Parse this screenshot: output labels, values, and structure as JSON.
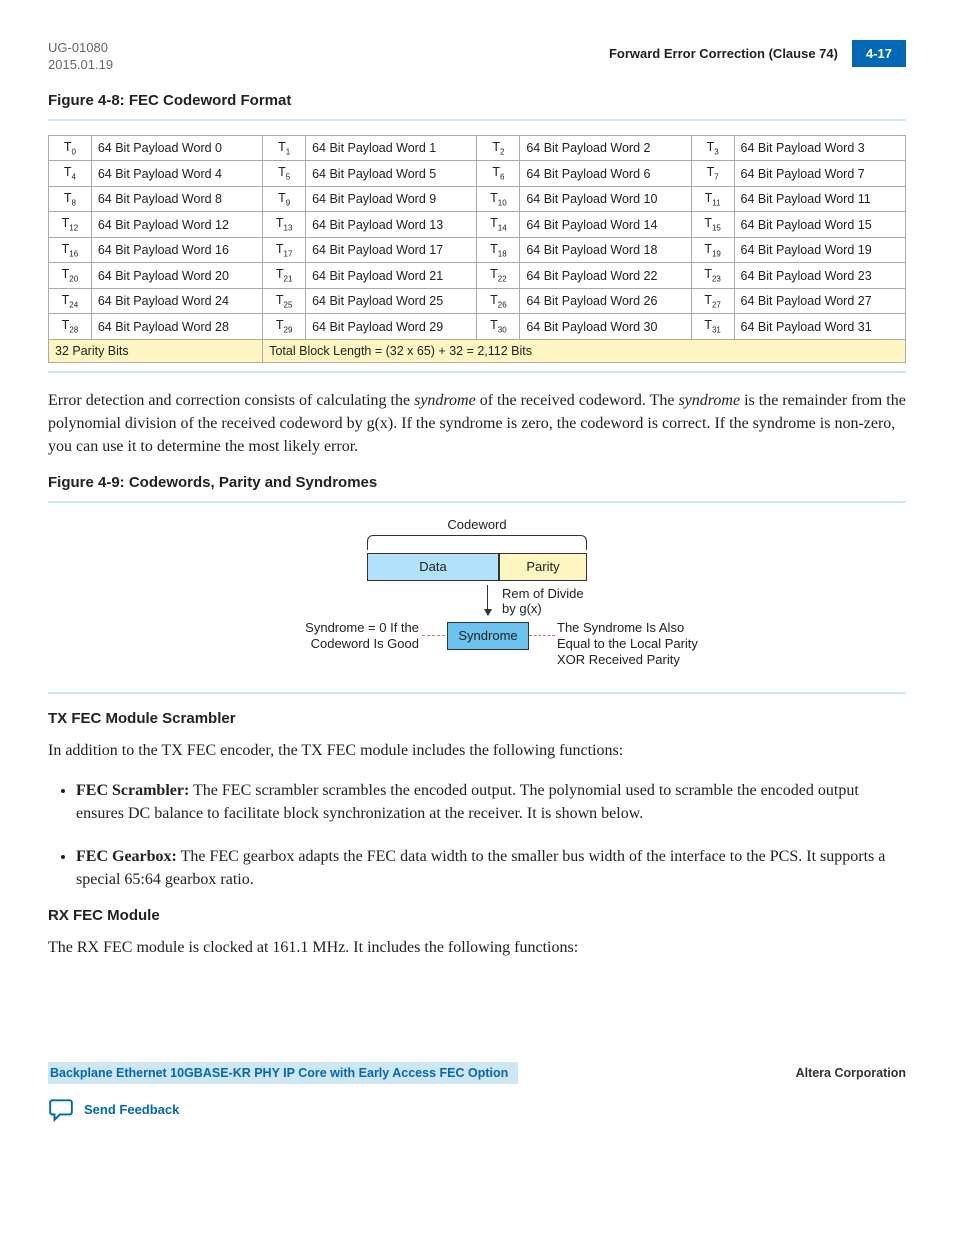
{
  "header": {
    "doc_id": "UG-01080",
    "date": "2015.01.19",
    "section_title": "Forward Error Correction (Clause 74)",
    "page_number": "4-17"
  },
  "figure48": {
    "caption": "Figure 4-8: FEC Codeword Format",
    "parity_label": "32 Parity Bits",
    "block_length": "Total Block Length = (32 x 65) + 32 = 2,112 Bits"
  },
  "paragraph1": {
    "part1": "Error detection and correction consists of calculating the ",
    "em1": "syndrome",
    "part2": " of the received codeword. The ",
    "em2": "syndrome",
    "part3": " is the remainder from the polynomial division of the received codeword by g(x). If the syndrome is zero, the codeword is correct. If the syndrome is non-zero, you can use it to determine the most likely error."
  },
  "figure49": {
    "caption": "Figure 4-9: Codewords, Parity and Syndromes",
    "codeword": "Codeword",
    "data": "Data",
    "parity": "Parity",
    "rem1": "Rem of Divide",
    "rem2": "by g(x)",
    "syndrome": "Syndrome",
    "left1": "Syndrome = 0 If the",
    "left2": "Codeword Is Good",
    "right1": "The Syndrome Is Also",
    "right2": "Equal to the Local Parity",
    "right3": "XOR Received Parity"
  },
  "tx_heading": "TX FEC Module Scrambler",
  "tx_intro": "In addition to the TX FEC encoder, the TX FEC module includes the following functions:",
  "tx_items": {
    "scrambler_label": "FEC Scrambler:",
    "scrambler_text": " The FEC scrambler scrambles the encoded output. The polynomial used to scramble the encoded output ensures DC balance to facilitate block synchronization at the receiver. It is shown below.",
    "gearbox_label": "FEC Gearbox:",
    "gearbox_text": " The FEC gearbox adapts the FEC data width to the smaller bus width of the interface to the PCS. It supports a special 65:64 gearbox ratio."
  },
  "rx_heading": "RX FEC Module",
  "rx_intro": "The RX FEC module is clocked at 161.1 MHz. It includes the following functions:",
  "footer": {
    "left": "Backplane Ethernet 10GBASE-KR PHY IP Core with Early Access FEC Option",
    "right": "Altera Corporation"
  },
  "feedback": "Send Feedback",
  "chart_data": {
    "type": "table",
    "title": "FEC Codeword Format",
    "rows": [
      [
        {
          "t": 0,
          "p": "64 Bit Payload Word 0"
        },
        {
          "t": 1,
          "p": "64 Bit Payload Word 1"
        },
        {
          "t": 2,
          "p": "64 Bit Payload Word 2"
        },
        {
          "t": 3,
          "p": "64 Bit Payload Word 3"
        }
      ],
      [
        {
          "t": 4,
          "p": "64 Bit Payload Word 4"
        },
        {
          "t": 5,
          "p": "64 Bit Payload Word 5"
        },
        {
          "t": 6,
          "p": "64 Bit Payload Word 6"
        },
        {
          "t": 7,
          "p": "64 Bit Payload Word 7"
        }
      ],
      [
        {
          "t": 8,
          "p": "64 Bit Payload Word 8"
        },
        {
          "t": 9,
          "p": "64 Bit Payload Word 9"
        },
        {
          "t": 10,
          "p": "64 Bit Payload Word 10"
        },
        {
          "t": 11,
          "p": "64 Bit Payload Word 11"
        }
      ],
      [
        {
          "t": 12,
          "p": "64 Bit Payload Word 12"
        },
        {
          "t": 13,
          "p": "64 Bit Payload Word 13"
        },
        {
          "t": 14,
          "p": "64 Bit Payload Word 14"
        },
        {
          "t": 15,
          "p": "64 Bit Payload Word 15"
        }
      ],
      [
        {
          "t": 16,
          "p": "64 Bit Payload Word 16"
        },
        {
          "t": 17,
          "p": "64 Bit Payload Word 17"
        },
        {
          "t": 18,
          "p": "64 Bit Payload Word 18"
        },
        {
          "t": 19,
          "p": "64 Bit Payload Word 19"
        }
      ],
      [
        {
          "t": 20,
          "p": "64 Bit Payload Word 20"
        },
        {
          "t": 21,
          "p": "64 Bit Payload Word 21"
        },
        {
          "t": 22,
          "p": "64 Bit Payload Word 22"
        },
        {
          "t": 23,
          "p": "64 Bit Payload Word 23"
        }
      ],
      [
        {
          "t": 24,
          "p": "64 Bit Payload Word 24"
        },
        {
          "t": 25,
          "p": "64 Bit Payload Word 25"
        },
        {
          "t": 26,
          "p": "64 Bit Payload Word 26"
        },
        {
          "t": 27,
          "p": "64 Bit Payload Word 27"
        }
      ],
      [
        {
          "t": 28,
          "p": "64 Bit Payload Word 28"
        },
        {
          "t": 29,
          "p": "64 Bit Payload Word 29"
        },
        {
          "t": 30,
          "p": "64 Bit Payload Word 30"
        },
        {
          "t": 31,
          "p": "64 Bit Payload Word 31"
        }
      ]
    ],
    "footer_left": "32 Parity Bits",
    "footer_right": "Total Block Length = (32 x 65) + 32 = 2,112 Bits"
  }
}
